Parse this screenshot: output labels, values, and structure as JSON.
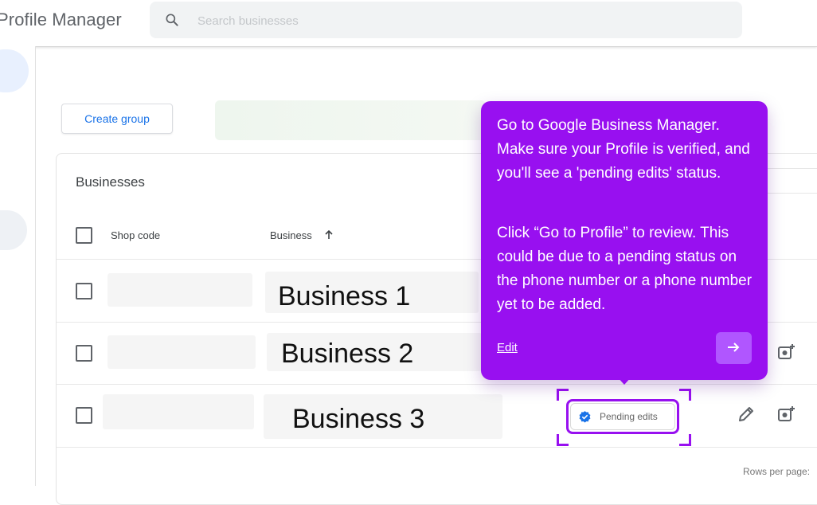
{
  "header": {
    "app_title": "Profile Manager",
    "search_placeholder": "Search businesses"
  },
  "toolbar": {
    "create_group_label": "Create group"
  },
  "table": {
    "title": "Businesses",
    "columns": [
      "Shop code",
      "Business"
    ],
    "rows": [
      {
        "business": "Business 1"
      },
      {
        "business": "Business 2"
      },
      {
        "business": "Business 3",
        "status": "Pending edits"
      }
    ],
    "footer_text": "Rows per page:"
  },
  "tooltip": {
    "paragraph1": "Go to Google Business Manager. Make sure your Profile is verified, and you'll see a 'pending edits' status.",
    "paragraph2": "Click “Go to Profile” to review. This could be due to a pending status on the phone number or a phone number yet to be added.",
    "link_label": "Edit",
    "next_icon": "arrow-right-icon"
  },
  "colors": {
    "accent": "#9810f0",
    "link_blue": "#1a73e8",
    "verified_blue": "#1a73e8"
  },
  "icons": {
    "search": "search-icon",
    "sort": "arrow-up-icon",
    "edit": "pencil-icon",
    "photo": "add-photo-icon",
    "verified": "verified-check-icon"
  }
}
